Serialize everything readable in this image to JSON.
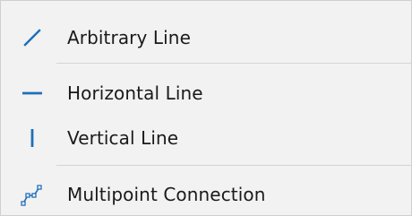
{
  "menu": {
    "items": [
      {
        "label": "Arbitrary Line",
        "icon": "diagonal-line-icon"
      },
      {
        "label": "Horizontal Line",
        "icon": "horizontal-line-icon"
      },
      {
        "label": "Vertical Line",
        "icon": "vertical-line-icon"
      },
      {
        "label": "Multipoint Connection",
        "icon": "multipoint-connection-icon"
      }
    ],
    "accent_color": "#1f6fb7",
    "separator_color": "#d4d4d4",
    "background_color": "#f2f2f2"
  }
}
